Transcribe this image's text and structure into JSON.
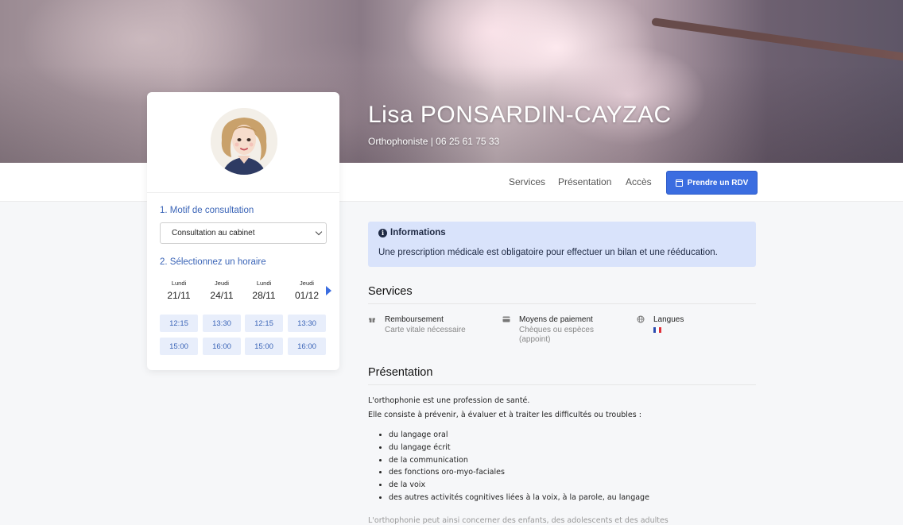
{
  "hero": {
    "name": "Lisa PONSARDIN-CAYZAC",
    "subtitle": "Orthophoniste | 06 25 61 75 33"
  },
  "nav": {
    "links": [
      "Services",
      "Présentation",
      "Accès"
    ],
    "rdv_label": "Prendre un RDV"
  },
  "booking": {
    "step1_title": "1. Motif de consultation",
    "motif_selected": "Consultation au cabinet",
    "step2_title": "2. Sélectionnez un horaire",
    "days": [
      {
        "name": "Lundi",
        "date": "21/11",
        "slots": [
          "12:15",
          "15:00"
        ]
      },
      {
        "name": "Jeudi",
        "date": "24/11",
        "slots": [
          "13:30",
          "16:00"
        ]
      },
      {
        "name": "Lundi",
        "date": "28/11",
        "slots": [
          "12:15",
          "15:00"
        ]
      },
      {
        "name": "Jeudi",
        "date": "01/12",
        "slots": [
          "13:30",
          "16:00"
        ]
      }
    ]
  },
  "info": {
    "title": "Informations",
    "text": "Une prescription médicale est obligatoire pour effectuer un bilan et une rééducation."
  },
  "services": {
    "title": "Services",
    "items": [
      {
        "label": "Remboursement",
        "value": "Carte vitale nécessaire",
        "icon": "gift-icon"
      },
      {
        "label": "Moyens de paiement",
        "value": "Chèques ou espèces (appoint)",
        "icon": "credit-card-icon"
      },
      {
        "label": "Langues",
        "value": "",
        "icon": "globe-icon"
      }
    ]
  },
  "presentation": {
    "title": "Présentation",
    "intro1": "L'orthophonie est une profession de santé.",
    "intro2": "Elle consiste à prévenir, à évaluer et à traiter les difficultés ou troubles :",
    "list": [
      "du langage oral",
      "du langage écrit",
      "de la communication",
      "des fonctions oro-myo-faciales",
      "de la voix",
      "des autres activités cognitives liées à la voix, à la parole, au langage"
    ],
    "outro": "L'orthophonie peut ainsi concerner des enfants, des adolescents et des adultes"
  },
  "colors": {
    "accent": "#3b6de0",
    "info_bg": "#d9e3fb",
    "slot_bg": "#e8eefb"
  }
}
